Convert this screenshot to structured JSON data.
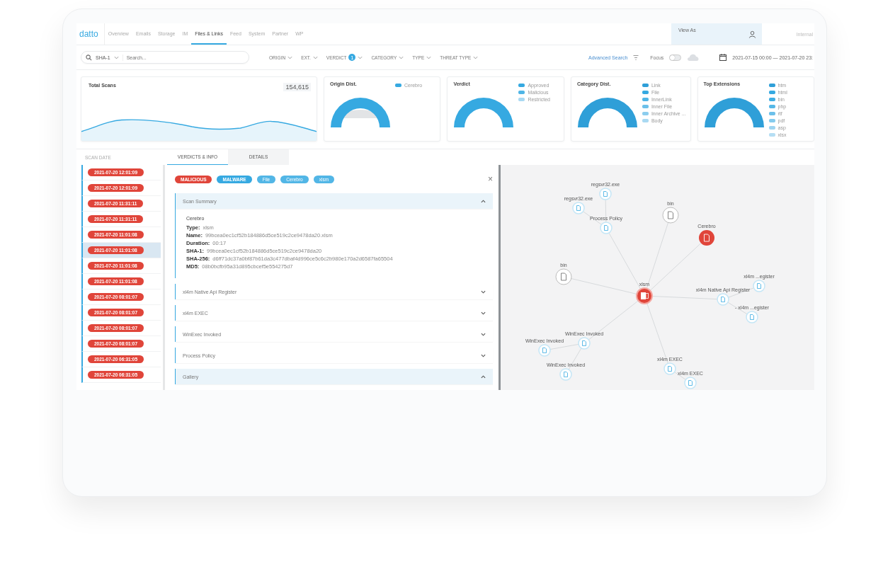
{
  "nav": {
    "logo": "datto",
    "tabs": [
      {
        "label": "Overview",
        "selected": false
      },
      {
        "label": "Emails",
        "selected": false
      },
      {
        "label": "Storage",
        "selected": false
      },
      {
        "label": "IM",
        "selected": false
      },
      {
        "label": "Files & Links",
        "selected": true
      },
      {
        "label": "Feed",
        "selected": false
      },
      {
        "label": "System",
        "selected": false
      },
      {
        "label": "Partner",
        "selected": false
      },
      {
        "label": "WP",
        "selected": false
      }
    ],
    "view_as": {
      "label": "View As"
    },
    "account": "Internal"
  },
  "filters": {
    "search_type": "SHA-1",
    "search": {
      "placeholder": "Search..."
    },
    "dropdowns": [
      {
        "label": "ORIGIN"
      },
      {
        "label": "EXT."
      },
      {
        "label": "VERDICT",
        "badge": "1"
      },
      {
        "label": "CATEGORY"
      },
      {
        "label": "TYPE"
      },
      {
        "label": "THREAT TYPE"
      }
    ],
    "advanced_search": "Advanced Search",
    "focus": {
      "label": "Focus",
      "on": false
    },
    "date_range": "2021-07-15 00:00 — 2021-07-20 23:"
  },
  "total_scans": {
    "title": "Total Scans",
    "count": "154,615"
  },
  "distribution_cards": [
    {
      "title": "Origin Dist.",
      "legend": [
        {
          "label": "Cerebro",
          "color": "#36a9e1"
        }
      ]
    },
    {
      "title": "Verdict",
      "legend": [
        {
          "label": "Approved",
          "color": "#36a9e1"
        },
        {
          "label": "Malicious",
          "color": "#4fb5e6"
        },
        {
          "label": "Restricted",
          "color": "#a9d9f2"
        }
      ]
    },
    {
      "title": "Category Dist.",
      "legend": [
        {
          "label": "Link",
          "color": "#2f9fd8"
        },
        {
          "label": "File",
          "color": "#36a9e1"
        },
        {
          "label": "InnerLink",
          "color": "#4fb5e6"
        },
        {
          "label": "Inner File",
          "color": "#6cc0ea"
        },
        {
          "label": "Inner Archive ...",
          "color": "#8ccdee"
        },
        {
          "label": "Body",
          "color": "#a9d9f2"
        }
      ]
    },
    {
      "title": "Top Extensions",
      "legend": [
        {
          "label": "htm",
          "color": "#2f9fd8"
        },
        {
          "label": "html",
          "color": "#36a9e1"
        },
        {
          "label": "bin",
          "color": "#3faee3"
        },
        {
          "label": "php",
          "color": "#55b8e7"
        },
        {
          "label": "rtf",
          "color": "#6cc0ea"
        },
        {
          "label": "pdf",
          "color": "#84cbee"
        },
        {
          "label": "asp",
          "color": "#9dd4f1"
        },
        {
          "label": "xlsx",
          "color": "#b5def4"
        }
      ]
    }
  ],
  "list_header": "SCAN DATE",
  "detail_tabs": [
    {
      "label": "VERDICTS & INFO",
      "selected": true
    },
    {
      "label": "DETAILS",
      "selected": false
    }
  ],
  "scans": [
    {
      "date": "2021-07-20 12:01:09",
      "selected": false
    },
    {
      "date": "2021-07-20 12:01:09",
      "selected": false
    },
    {
      "date": "2021-07-20 11:31:11",
      "selected": false
    },
    {
      "date": "2021-07-20 11:31:11",
      "selected": false
    },
    {
      "date": "2021-07-20 11:01:08",
      "selected": false
    },
    {
      "date": "2021-07-20 11:01:08",
      "selected": true
    },
    {
      "date": "2021-07-20 11:01:08",
      "selected": false
    },
    {
      "date": "2021-07-20 11:01:08",
      "selected": false
    },
    {
      "date": "2021-07-20 08:01:07",
      "selected": false
    },
    {
      "date": "2021-07-20 08:01:07",
      "selected": false
    },
    {
      "date": "2021-07-20 08:01:07",
      "selected": false
    },
    {
      "date": "2021-07-20 08:01:07",
      "selected": false
    },
    {
      "date": "2021-07-20 06:31:05",
      "selected": false
    },
    {
      "date": "2021-07-20 06:31:05",
      "selected": false
    }
  ],
  "tags": [
    {
      "label": "MALICIOUS",
      "color": "#e0453a"
    },
    {
      "label": "MALWARE",
      "color": "#36a9e1"
    },
    {
      "label": "File",
      "color": "#52b6e6"
    },
    {
      "label": "Cerebro",
      "color": "#52b6e6"
    },
    {
      "label": "xlsm",
      "color": "#52b6e6"
    }
  ],
  "close": "×",
  "sections": [
    {
      "title": "Scan Summary",
      "expanded": true,
      "engine": "Cerebro",
      "fields": [
        {
          "label": "Type:",
          "value": "xlsm"
        },
        {
          "label": "Name:",
          "value": "99bcea0ec1cf52b184886d5ce519c2ce9478da20.xlsm"
        },
        {
          "label": "Duration:",
          "value": "00:17"
        },
        {
          "label": "SHA-1:",
          "value": "99bcea0ec1cf52b184886d5ce519c2ce9478da20"
        },
        {
          "label": "SHA-256:",
          "value": "d6ff71dc37a0bf87b61da3c477dbaf4d996ce5c6c2b980e170a2d6587fa65504"
        },
        {
          "label": "MD5:",
          "value": "08b0bcfb95a31d895cbcef5e554275d7"
        }
      ]
    },
    {
      "title": "xl4m Native Api Register",
      "expanded": false
    },
    {
      "title": "xl4m EXEC",
      "expanded": false
    },
    {
      "title": "WinExec Invoked",
      "expanded": false
    },
    {
      "title": "Process Policy",
      "expanded": false
    },
    {
      "title": "Gallery",
      "expanded": true
    }
  ],
  "graph": {
    "label": "xlsm",
    "kind": "root",
    "children": [
      {
        "label": "Process Policy",
        "kind": "file",
        "children": [
          {
            "label": "regsvr32.exe",
            "kind": "file"
          },
          {
            "label": "regsvr32.exe",
            "kind": "file"
          }
        ]
      },
      {
        "label": "bin",
        "kind": "binary"
      },
      {
        "label": "Cerebro",
        "kind": "alert"
      },
      {
        "label": "xl4m Native Api Register",
        "kind": "file",
        "children": [
          {
            "label": "xl4m ...egister",
            "kind": "file"
          },
          {
            "label": "- xl4m ...egister",
            "kind": "file"
          }
        ]
      },
      {
        "label": "xl4m EXEC",
        "kind": "file",
        "children": [
          {
            "label": "xl4m EXEC",
            "kind": "file"
          }
        ]
      },
      {
        "label": "bin",
        "kind": "binary"
      },
      {
        "label": "WinExec Invoked",
        "kind": "file",
        "children": [
          {
            "label": "WinExec Invoked",
            "kind": "file"
          },
          {
            "label": "WinExec Invoked",
            "kind": "file"
          }
        ]
      }
    ]
  }
}
